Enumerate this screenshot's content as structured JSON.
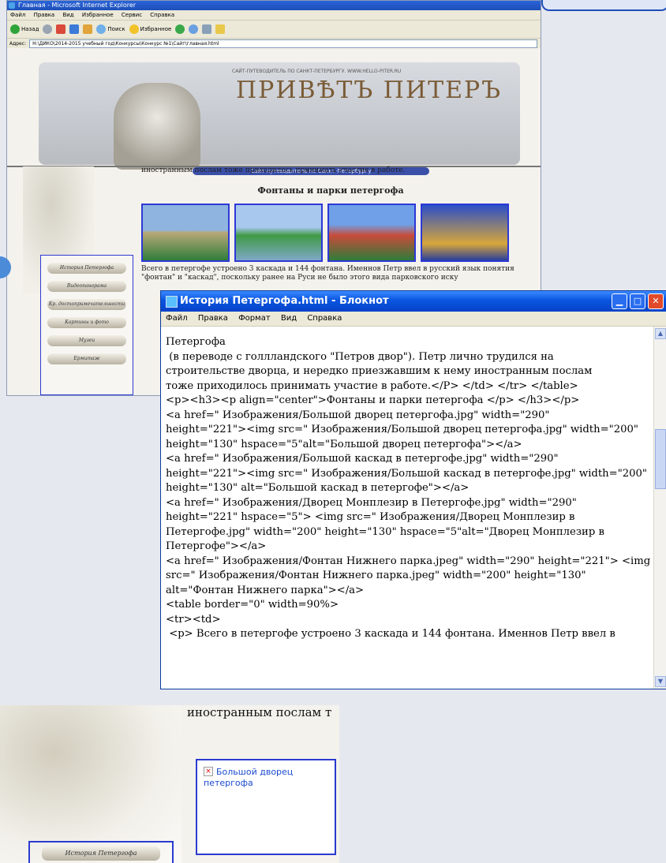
{
  "ie": {
    "title": "Главная - Microsoft Internet Explorer",
    "menu": [
      "Файл",
      "Правка",
      "Вид",
      "Избранное",
      "Сервис",
      "Справка"
    ],
    "toolbar": {
      "back": "Назад",
      "search": "Поиск",
      "favorites": "Избранное"
    },
    "address_label": "Адрес:",
    "address": "H:\\ДИКО\\2014-2015 учебный год\\Конкурсы\\Конкурс №1\\Сайт\\главная.html"
  },
  "site": {
    "tagline": "САЙТ-ПУТЕВОДИТЕЛЬ ПО САНКТ-ПЕТЕРБУРГУ. WWW.HELLO-PITER.RU",
    "logo": "ПРИВѢТЪ ПИТЕРЪ",
    "guide_bar": "Сайт путеводитель по Санкт-Петербургу",
    "intro_line": "иностранным послам тоже приходилось принимать участие в работе.",
    "heading": "Фонтаны и парки петергофа",
    "paragraph": "Всего в петергофе устроено 3 каскада и 144 фонтана. Именнов Петр ввел в русский язык понятия \"фонтан\" и \"каскад\", поскольку ранее на Руси не было этого вида парковского иску",
    "nav": [
      "История Петергофа",
      "Видеопанорама",
      "Кр. достопримечательности",
      "Картины и фото",
      "Музеи",
      "Ермитаж"
    ]
  },
  "notepad": {
    "title": "История Петергофа.html - Блокнот",
    "menu": [
      "Файл",
      "Правка",
      "Формат",
      "Вид",
      "Справка"
    ],
    "text": "Петергофа\n (в переводе с голлландского \"Петров двор\"). Петр лично трудился на\nстроительстве дворца, и нередко приезжавшим к нему иностранным послам\nтоже приходилось принимать участие в работе.</P> </td> </tr> </table>\n<p><h3><p align=\"center\">Фонтаны и парки петергофа </p> </h3></p>\n<a href=\" Изображения/Большой дворец петергофа.jpg\" width=\"290\"\nheight=\"221\"><img src=\" Изображения/Большой дворец петергофа.jpg\" width=\"200\"\nheight=\"130\" hspace=\"5\"alt=\"Большой дворец петергофа\"></a>\n<a href=\" Изображения/Большой каскад в петергофе.jpg\" width=\"290\"\nheight=\"221\"><img src=\" Изображения/Большой каскад в петергофе.jpg\" width=\"200\"\nheight=\"130\" alt=\"Большой каскад в петергофе\"></a>\n<a href=\" Изображения/Дворец Монплезир в Петергофе.jpg\" width=\"290\"\nheight=\"221\" hspace=\"5\"> <img src=\" Изображения/Дворец Монплезир в\nПетергофе.jpg\" width=\"200\" height=\"130\" hspace=\"5\"alt=\"Дворец Монплезир в\nПетергофе\"></a>\n<a href=\" Изображения/Фонтан Нижнего парка.jpeg\" width=\"290\" height=\"221\"> <img\nsrc=\" Изображения/Фонтан Нижнего парка.jpeg\" width=\"200\" height=\"130\"\nalt=\"Фонтан Нижнего парка\"></a>\n<table border=\"0\" width=90%>\n<tr><td>\n <p> Всего в петергофе устроено 3 каскада и 144 фонтана. Именнов Петр ввел в"
  },
  "crop": {
    "text": "иностранным послам т",
    "broken_image_alt": "Большой дворец петергофа",
    "nav_label": "История Петергофа"
  },
  "colors": {
    "xp_blue": "#0a55e0",
    "link_border": "#2d39d6"
  }
}
